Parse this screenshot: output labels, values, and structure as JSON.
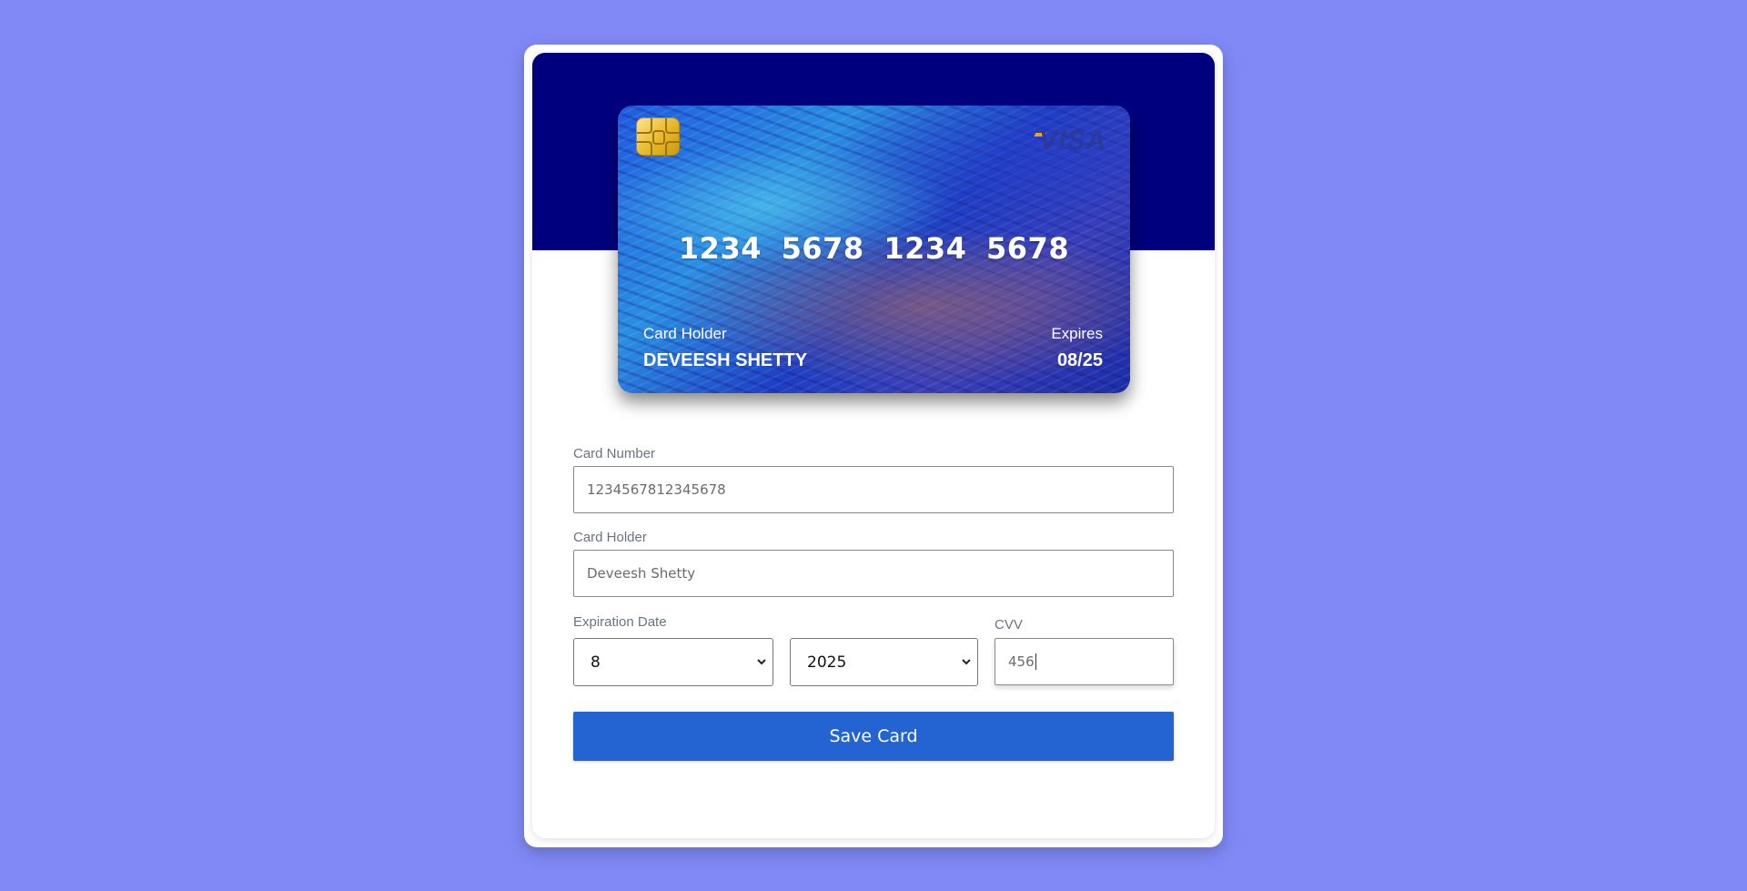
{
  "card": {
    "brand": "VISA",
    "number_display": "1234 5678 1234 5678",
    "holder_label": "Card Holder",
    "holder_name": "DEVEESH SHETTY",
    "expires_label": "Expires",
    "expires_value": "08/25"
  },
  "form": {
    "card_number": {
      "label": "Card Number",
      "value": "1234567812345678"
    },
    "card_holder": {
      "label": "Card Holder",
      "value": "Deveesh Shetty"
    },
    "expiration": {
      "label": "Expiration Date",
      "month": "8",
      "year": "2025"
    },
    "cvv": {
      "label": "CVV",
      "value": "456"
    },
    "save_label": "Save Card"
  },
  "colors": {
    "page_background": "#8189f7",
    "top_band": "#00007f",
    "button": "#2463d2"
  },
  "icons": [
    "card-chip-icon",
    "visa-logo-icon",
    "chevron-down-icon"
  ]
}
